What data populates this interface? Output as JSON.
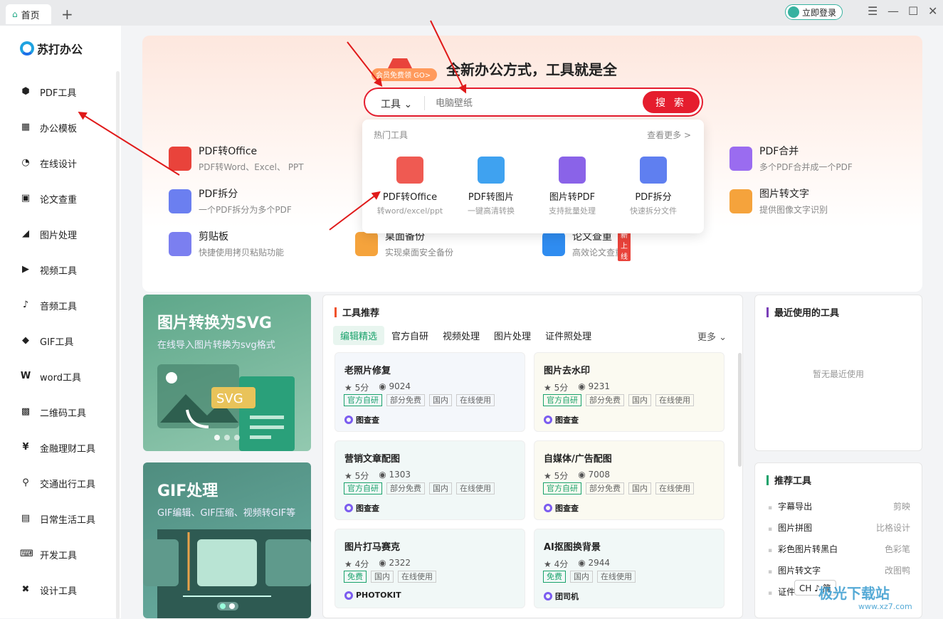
{
  "titlebar": {
    "tab_home": "首页",
    "tab_add": "+",
    "login": "立即登录",
    "menu_icon": "☰",
    "min_icon": "—",
    "max_icon": "☐",
    "close_icon": "✕"
  },
  "sidebar": {
    "logo": "苏打办公",
    "items": [
      {
        "label": "PDF工具",
        "icon": "pdf-icon"
      },
      {
        "label": "办公模板",
        "icon": "template-icon"
      },
      {
        "label": "在线设计",
        "icon": "design-icon"
      },
      {
        "label": "论文查重",
        "icon": "paper-check-icon"
      },
      {
        "label": "图片处理",
        "icon": "image-icon"
      },
      {
        "label": "视频工具",
        "icon": "video-icon"
      },
      {
        "label": "音频工具",
        "icon": "audio-icon"
      },
      {
        "label": "GIF工具",
        "icon": "gif-icon"
      },
      {
        "label": "word工具",
        "icon": "word-icon"
      },
      {
        "label": "二维码工具",
        "icon": "qrcode-icon"
      },
      {
        "label": "金融理财工具",
        "icon": "finance-icon"
      },
      {
        "label": "交通出行工具",
        "icon": "location-icon"
      },
      {
        "label": "日常生活工具",
        "icon": "calendar-icon"
      },
      {
        "label": "开发工具",
        "icon": "code-icon"
      },
      {
        "label": "设计工具",
        "icon": "tools-icon"
      }
    ]
  },
  "hero": {
    "promo": "会员免费领 GO>",
    "title": "全新办公方式，工具就是全",
    "search_type": "工具",
    "search_placeholder": "电脑壁纸",
    "search_button": "搜 索"
  },
  "tools": [
    {
      "name": "PDF转Office",
      "desc": "PDF转Word、Excel、 PPT"
    },
    {
      "name": "PDF拆分",
      "desc": "一个PDF拆分为多个PDF"
    },
    {
      "name": "剪贴板",
      "desc": "快捷使用拷贝粘贴功能"
    },
    {
      "name": "桌面备份",
      "desc": "实现桌面安全备份"
    },
    {
      "name": "论文查重",
      "desc": "高效论文查重",
      "badge": "新上线"
    },
    {
      "name": "PDF合并",
      "desc": "多个PDF合并成一个PDF"
    },
    {
      "name": "图片转文字",
      "desc": "提供图像文字识别"
    }
  ],
  "dropdown": {
    "heading": "热门工具",
    "more": "查看更多 >",
    "items": [
      {
        "name": "PDF转Office",
        "desc": "转word/excel/ppt"
      },
      {
        "name": "PDF转图片",
        "desc": "一键高清转换"
      },
      {
        "name": "图片转PDF",
        "desc": "支持批量处理"
      },
      {
        "name": "PDF拆分",
        "desc": "快速拆分文件"
      }
    ]
  },
  "banners": [
    {
      "title": "图片转换为SVG",
      "subtitle": "在线导入图片转换为svg格式",
      "art_text": "SVG"
    },
    {
      "title": "GIF处理",
      "subtitle": "GIF编辑、GIF压缩、视频转GIF等"
    }
  ],
  "recommend": {
    "title": "工具推荐",
    "tabs": [
      "编辑精选",
      "官方自研",
      "视频处理",
      "图片处理",
      "证件照处理"
    ],
    "more": "更多",
    "cards": [
      {
        "title": "老照片修复",
        "rating": "5分",
        "views": "9024",
        "tags": [
          "官方自研",
          "部分免费",
          "国内",
          "在线使用"
        ],
        "brand": "图查查"
      },
      {
        "title": "图片去水印",
        "rating": "5分",
        "views": "9231",
        "tags": [
          "官方自研",
          "部分免费",
          "国内",
          "在线使用"
        ],
        "brand": "图查查"
      },
      {
        "title": "营销文章配图",
        "rating": "5分",
        "views": "1303",
        "tags": [
          "官方自研",
          "部分免费",
          "国内",
          "在线使用"
        ],
        "brand": "图查查"
      },
      {
        "title": "自媒体/广告配图",
        "rating": "5分",
        "views": "7008",
        "tags": [
          "官方自研",
          "部分免费",
          "国内",
          "在线使用"
        ],
        "brand": "图查查"
      },
      {
        "title": "图片打马赛克",
        "rating": "4分",
        "views": "2322",
        "tags": [
          "免费",
          "国内",
          "在线使用"
        ],
        "brand": "PHOTOKIT"
      },
      {
        "title": "AI抠图换背景",
        "rating": "4分",
        "views": "2944",
        "tags": [
          "免费",
          "国内",
          "在线使用"
        ],
        "brand": "团司机"
      }
    ]
  },
  "recent": {
    "title": "最近使用的工具",
    "empty": "暂无最近使用"
  },
  "suggest": {
    "title": "推荐工具",
    "items": [
      {
        "name": "字幕导出",
        "source": "剪映"
      },
      {
        "name": "图片拼图",
        "source": "比格设计"
      },
      {
        "name": "彩色图片转黑白",
        "source": "色彩笔"
      },
      {
        "name": "图片转文字",
        "source": "改图鸭"
      },
      {
        "name": "证件",
        "source": ""
      }
    ]
  },
  "ime": "CH ♪ 简",
  "watermark": {
    "main": "极光下载站",
    "url": "www.xz7.com"
  },
  "colors": {
    "accent_red": "#e51d2e",
    "accent_green": "#19a26b"
  }
}
